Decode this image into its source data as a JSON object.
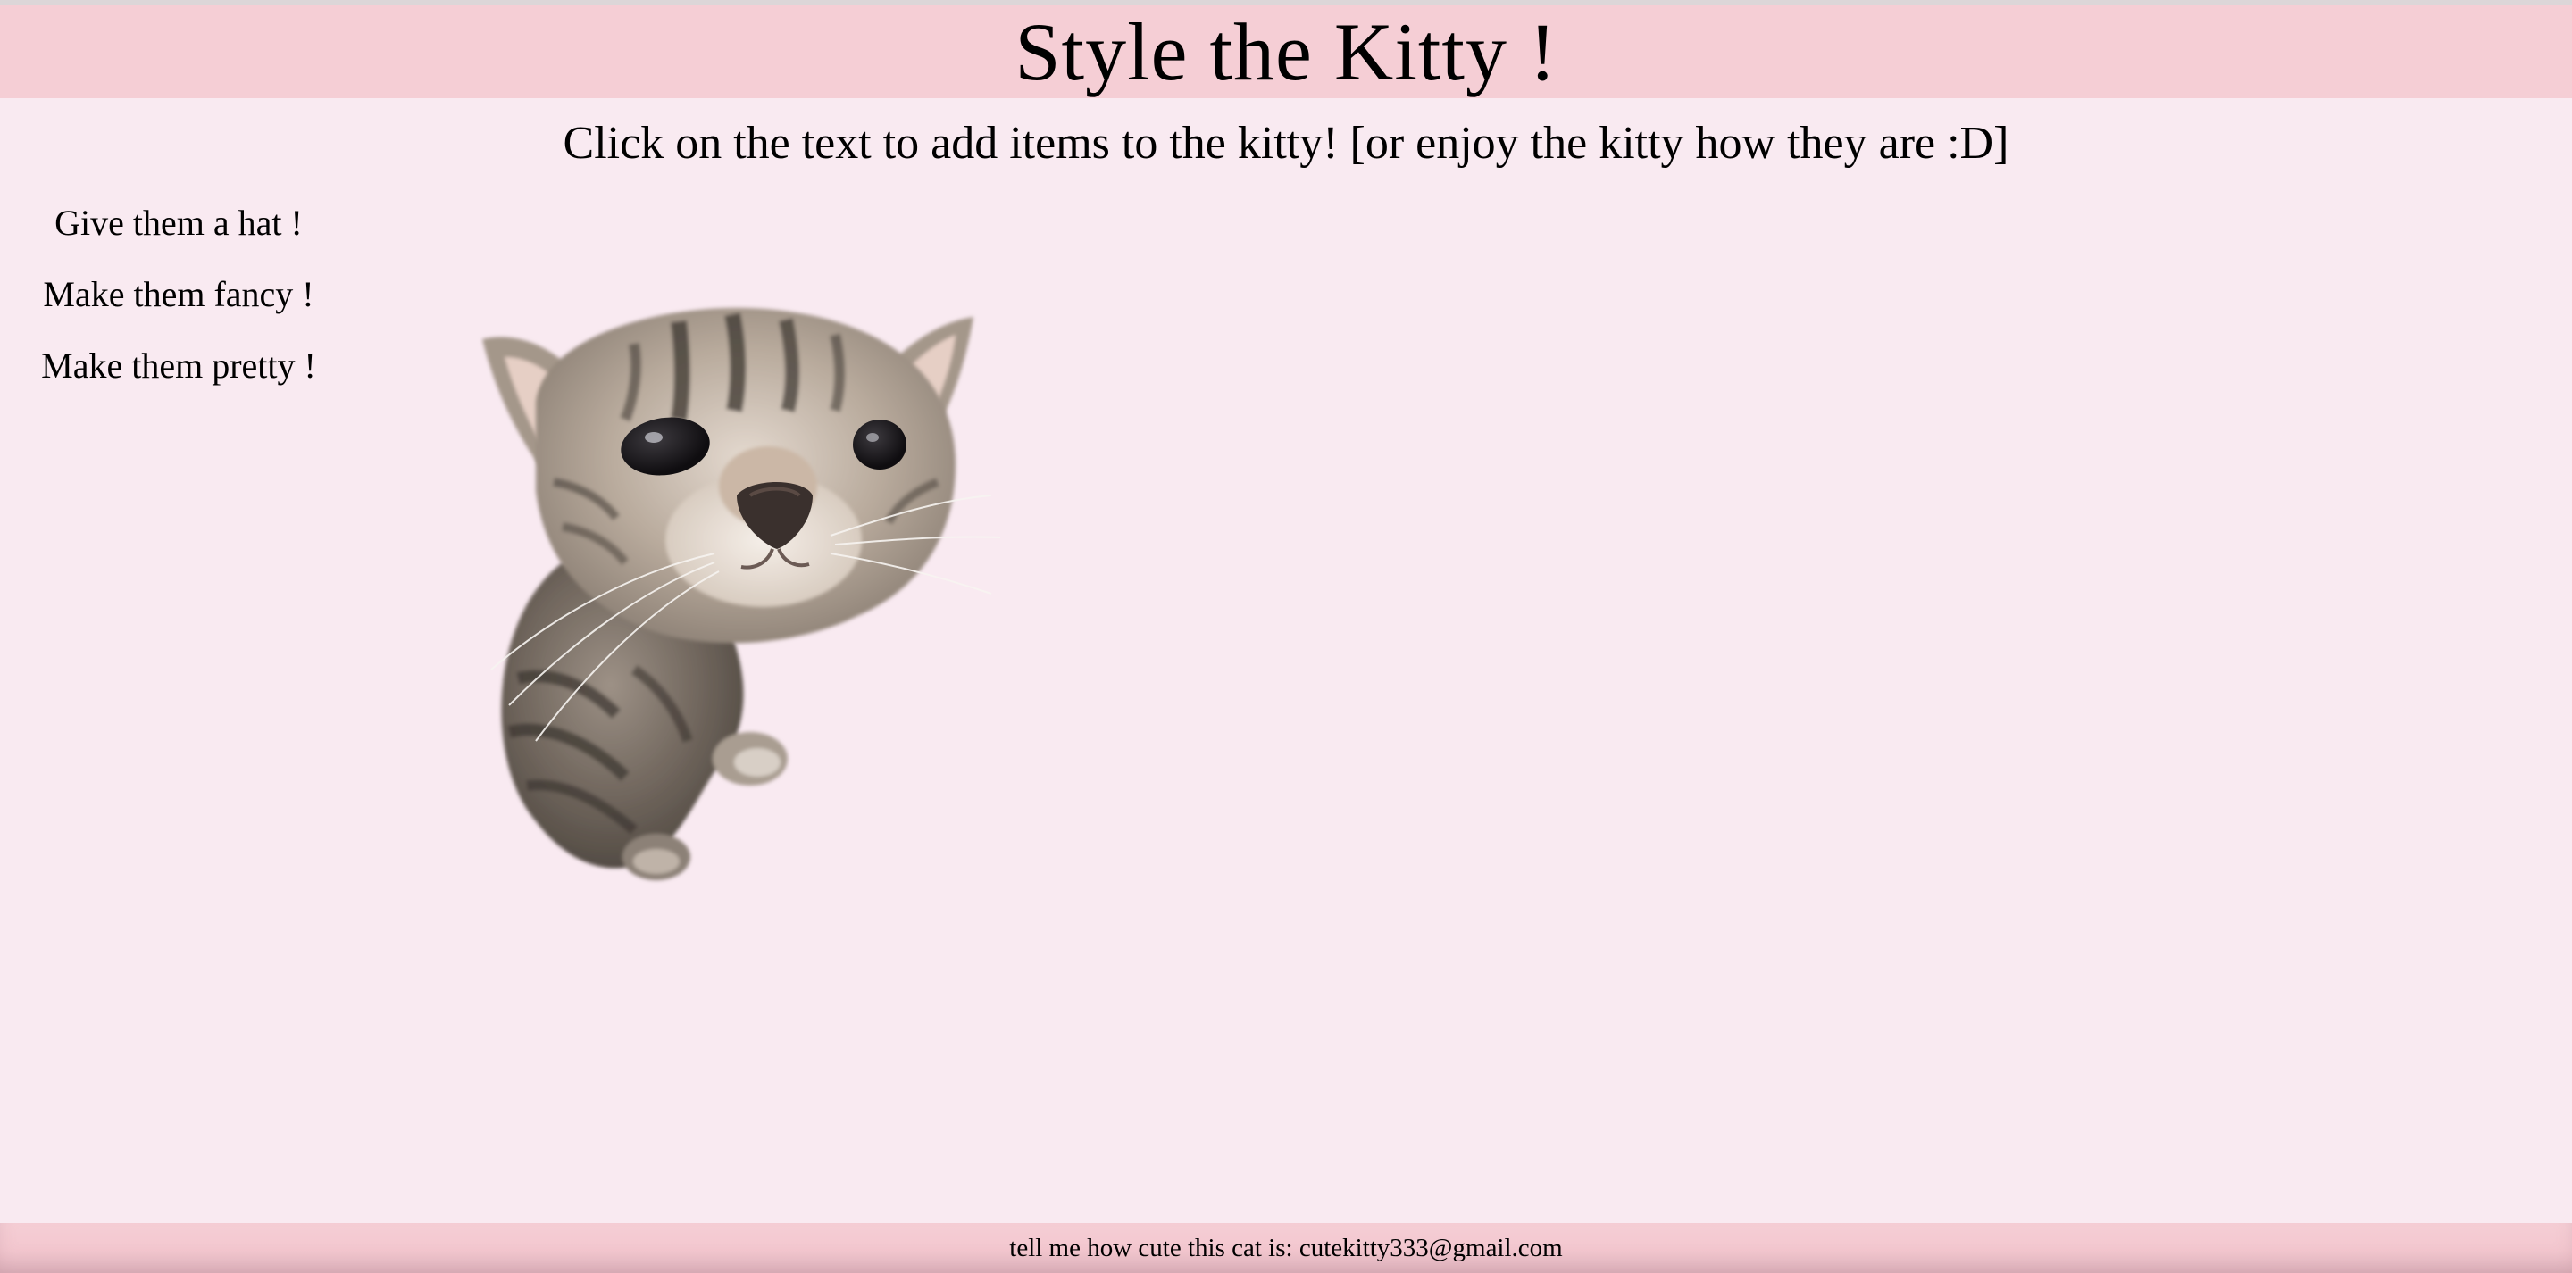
{
  "header": {
    "title": "Style the Kitty !"
  },
  "instructions": "Click on the text to add items to the kitty! [or enjoy the kitty how they are :D]",
  "menu": {
    "items": [
      {
        "label": "Give them a hat !"
      },
      {
        "label": "Make them fancy !"
      },
      {
        "label": "Make them pretty !"
      }
    ]
  },
  "footer": {
    "text": "tell me how cute this cat is: cutekitty333@gmail.com"
  },
  "colors": {
    "page_background": "#f9eaf1",
    "header_background": "#f5ced5",
    "footer_background": "#f5ced5"
  }
}
